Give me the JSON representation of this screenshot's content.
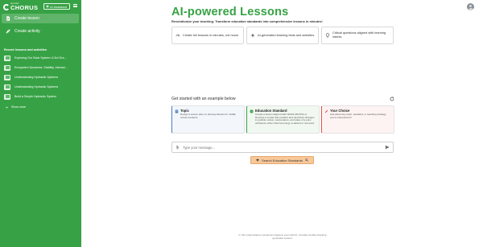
{
  "sidebar": {
    "brand_small": "wonder",
    "brand_main": "CHORUS",
    "ai_assistant_label": "AI Assistant",
    "nav": [
      {
        "label": "Create lesson",
        "icon": "document-icon",
        "active": true
      },
      {
        "label": "Create activity",
        "icon": "rocket-icon",
        "active": false
      }
    ],
    "recent_title": "Recent lessons and activities",
    "recent": [
      "Exploring Our Solar System: A 3rd Gra…",
      "Ecosystem Dynamics: Stability, Interact…",
      "Understanding Hydraulic Systems",
      "Understanding Hydraulic Systems",
      "Build a Simple Hydraulic System"
    ],
    "show_more": "Show more"
  },
  "header": {
    "title": "AI-powered Lessons",
    "subtitle_bold": "Revolutionize your teaching: Transform education standards into comprehensive lessons in minutes!"
  },
  "features": [
    {
      "text": "Create full lessons in minutes, not hours",
      "icon": "speedometer-icon"
    },
    {
      "text": "AI-generated learning tests and activities",
      "icon": "sparkle-icon"
    },
    {
      "text": "Critical questions aligned with learning intents",
      "icon": "lightbulb-icon"
    }
  ],
  "examples": {
    "heading": "Get started with an example below",
    "cards": [
      {
        "title": "Topic",
        "desc": "Design a lesson plan on photosynthesis for middle school students",
        "color": "#4a7fc1"
      },
      {
        "title": "Education Standard",
        "desc": "Create a lesson aligned with NGSS MS-PS1-4: Develop a model that predicts and describes changes in particle motion, temperature, and state of a pure substance when thermal energy is added or removed.",
        "color": "#37a245"
      },
      {
        "title": "Your Choice",
        "desc": "Ask about any topic, standard, or teaching strategy you're interested in!",
        "color": "#d9534f"
      }
    ]
  },
  "composer": {
    "placeholder": "Type your message..."
  },
  "search_standards_label": "Search Education Standards",
  "disclaimer": "In this small instance sometimes happens even with AI. Consider double-checking generated content.",
  "colors": {
    "brand_green": "#37a245",
    "search_button": "#f8c89a"
  }
}
